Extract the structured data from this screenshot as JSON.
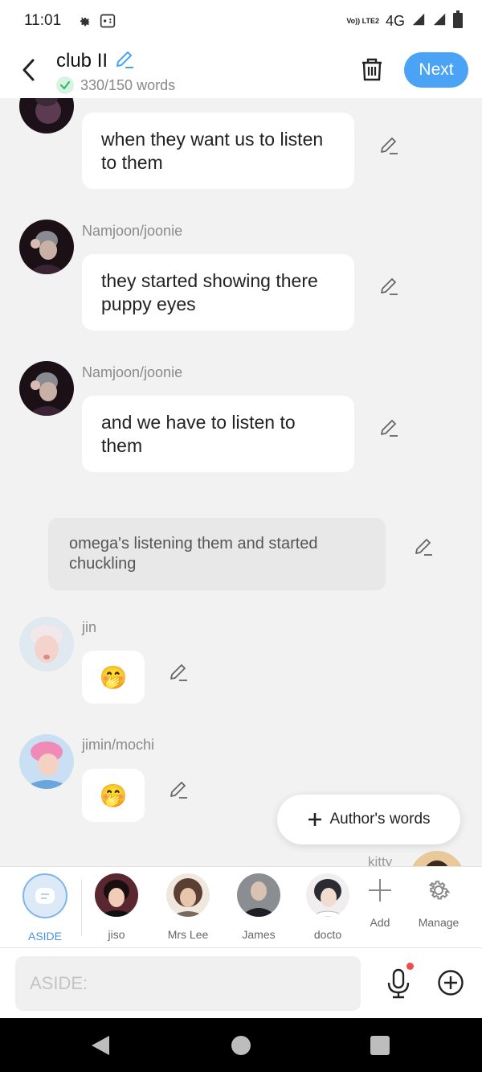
{
  "status_bar": {
    "time": "11:01",
    "network_label": "Vo)) LTE2",
    "network_type": "4G"
  },
  "header": {
    "title": "club II",
    "word_count": "330/150 words",
    "next_label": "Next"
  },
  "messages": [
    {
      "sender": "",
      "text": "when they want us to listen to them"
    },
    {
      "sender": "Namjoon/joonie",
      "text": "they started showing there puppy eyes"
    },
    {
      "sender": "Namjoon/joonie",
      "text": "and we have to listen to them"
    }
  ],
  "aside": {
    "text": "omega's listening them and started chuckling"
  },
  "emoji_messages": [
    {
      "sender": "jin",
      "emoji": "🤭"
    },
    {
      "sender": "jimin/mochi",
      "emoji": "🤭"
    }
  ],
  "authors_words_label": "Author's words",
  "partial_sender": "kitty",
  "characters": [
    {
      "name": "ASIDE",
      "active": true
    },
    {
      "name": "jiso"
    },
    {
      "name": "Mrs Lee"
    },
    {
      "name": "James"
    },
    {
      "name": "docto"
    }
  ],
  "tools": {
    "add_label": "Add",
    "manage_label": "Manage"
  },
  "input": {
    "placeholder": "ASIDE:"
  },
  "colors": {
    "accent": "#4aa3f5",
    "success": "#2ebd6b",
    "record_dot": "#f24b4b"
  }
}
